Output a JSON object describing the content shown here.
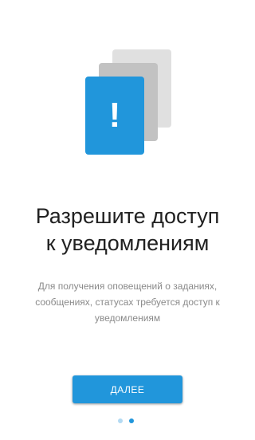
{
  "illustration": {
    "icon": "alert-exclamation-icon",
    "glyph": "!",
    "colors": {
      "front_card": "#2196db",
      "middle_card": "#c2c2c2",
      "back_card": "#e0e0e0"
    }
  },
  "title": {
    "line1": "Разрешите доступ",
    "line2": "к уведомлениям"
  },
  "description": {
    "line1": "Для получения оповещений о заданиях,",
    "line2": "сообщениях, статусах требуется доступ к",
    "line3": "уведомлениям"
  },
  "next_button": {
    "label": "ДАЛЕЕ"
  },
  "pager": {
    "total_pages": 2,
    "current_page": 2,
    "active_color": "#2196db",
    "inactive_color": "#b3daf3"
  },
  "colors": {
    "accent": "#2196db",
    "title_text": "#212121",
    "description_text": "#8a8a8a"
  }
}
